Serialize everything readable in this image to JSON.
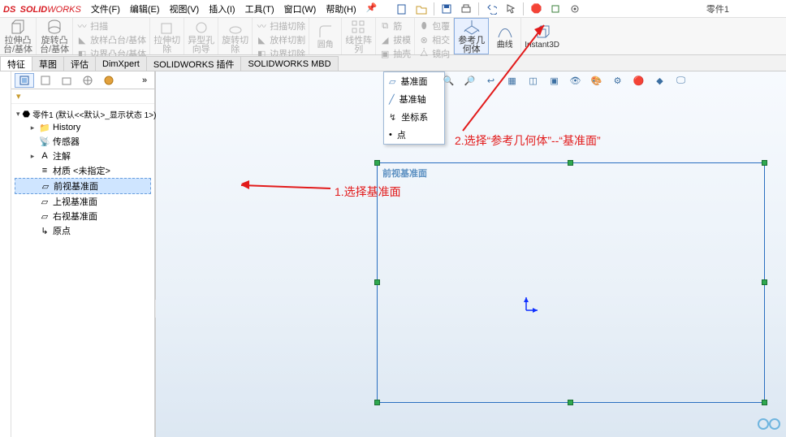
{
  "app": {
    "name": "SOLIDWORKS",
    "doc_label": "零件1"
  },
  "menu": {
    "file": "文件(F)",
    "edit": "编辑(E)",
    "view": "视图(V)",
    "insert": "插入(I)",
    "tools": "工具(T)",
    "window": "窗口(W)",
    "help": "帮助(H)"
  },
  "ribbon": {
    "extrude_boss": {
      "l1": "拉伸凸",
      "l2": "台/基体"
    },
    "revolve_boss": {
      "l1": "旋转凸",
      "l2": "台/基体"
    },
    "sweep": "扫描",
    "loft": "放样凸台/基体",
    "boundary": "边界凸台/基体",
    "extrude_cut": {
      "l1": "拉伸切",
      "l2": "除"
    },
    "hole": {
      "l1": "异型孔",
      "l2": "向导"
    },
    "revolve_cut": {
      "l1": "旋转切",
      "l2": "除"
    },
    "sweep_cut": "扫描切除",
    "loft_cut": "放样切割",
    "boundary_cut": "边界切除",
    "fillet": "圆角",
    "pattern": {
      "l1": "线性阵",
      "l2": "列"
    },
    "rib": "筋",
    "draft": "拔模",
    "shell": "抽壳",
    "wrap": "包覆",
    "intersect": "相交",
    "mirror": "镜向",
    "ref_geom": {
      "l1": "参考几",
      "l2": "何体"
    },
    "curves": "曲线",
    "instant3d": "Instant3D"
  },
  "tabs": {
    "features": "特征",
    "sketch": "草图",
    "evaluate": "评估",
    "dimxpert": "DimXpert",
    "addins": "SOLIDWORKS 插件",
    "mbd": "SOLIDWORKS MBD"
  },
  "tree": {
    "root": "零件1 (默认<<默认>_显示状态 1>)",
    "history": "History",
    "sensors": "传感器",
    "annotations": "注解",
    "material": "材质 <未指定>",
    "front_plane": "前视基准面",
    "top_plane": "上视基准面",
    "right_plane": "右视基准面",
    "origin": "原点"
  },
  "dropdown": {
    "plane": "基准面",
    "axis": "基准轴",
    "coord": "坐标系",
    "point": "点"
  },
  "viewport": {
    "plane_label": "前视基准面"
  },
  "annotations": {
    "step1": "1.选择基准面",
    "step2": "2.选择“参考几何体”--“基准面”"
  }
}
